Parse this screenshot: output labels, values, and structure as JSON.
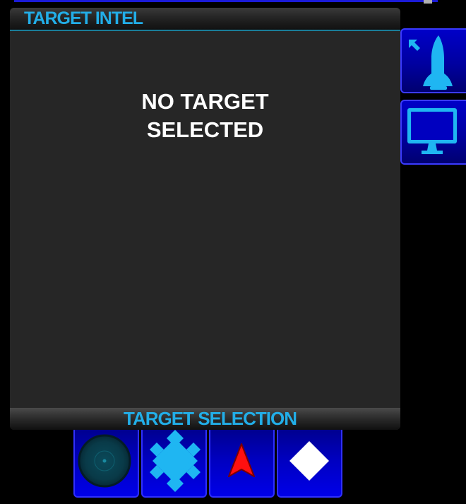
{
  "panel": {
    "title": "TARGET INTEL",
    "empty_line1": "NO TARGET",
    "empty_line2": "SELECTED",
    "footer": "TARGET SELECTION"
  },
  "side_buttons": [
    {
      "icon": "ship-jump-icon"
    },
    {
      "icon": "monitor-icon"
    }
  ],
  "target_buttons": [
    {
      "icon": "radar-icon"
    },
    {
      "icon": "cluster-diamond-icon"
    },
    {
      "icon": "red-arrow-icon"
    },
    {
      "icon": "white-diamond-icon"
    }
  ],
  "colors": {
    "accent": "#22aee8",
    "panel_bg": "#262626",
    "button_blue": "#0000c8",
    "arrow_red": "#ff1010"
  }
}
